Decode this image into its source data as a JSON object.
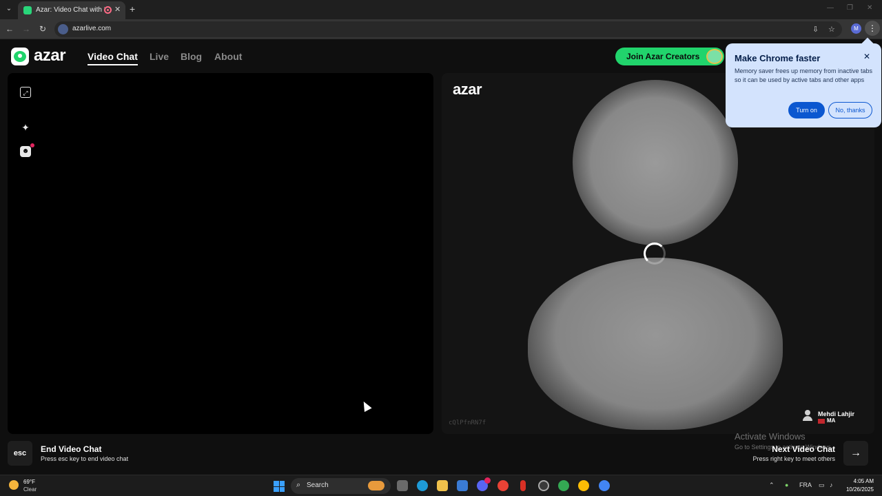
{
  "browser": {
    "tab_title": "Azar: Video Chat with New",
    "tab_close": "✕",
    "new_tab": "+",
    "url": "azarlive.com",
    "profile_initial": "M"
  },
  "site": {
    "logo_text": "azar",
    "nav": [
      "Video Chat",
      "Live",
      "Blog",
      "About"
    ],
    "active_nav": "Video Chat",
    "creators_button": "Join Azar Creators"
  },
  "remote": {
    "logo_text": "azar",
    "user_code": "cQlPfnRN7f",
    "peer_name": "Mehdi Lahjir",
    "peer_country": "MA"
  },
  "controls": {
    "esc_key": "esc",
    "end_title": "End Video Chat",
    "end_subtitle": "Press esc key to end video chat",
    "next_title": "Next Video Chat",
    "next_subtitle": "Press right key to meet others",
    "next_arrow": "→"
  },
  "watermark": {
    "title": "Activate Windows",
    "subtitle": "Go to Settings to activate Windows."
  },
  "popup": {
    "title": "Make Chrome faster",
    "body": "Memory saver frees up memory from inactive tabs so it can be used by active tabs and other apps",
    "primary_button": "Turn on",
    "secondary_button": "No, thanks",
    "close": "✕"
  },
  "taskbar": {
    "weather_temp": "69°F",
    "weather_condition": "Clear",
    "search_label": "Search",
    "language": "FRA",
    "time": "4:05 AM",
    "date": "10/26/2025"
  },
  "colors": {
    "brand_green": "#21d46c",
    "chrome_accent": "#0b57d0",
    "popup_bg": "#d3e3fd"
  }
}
